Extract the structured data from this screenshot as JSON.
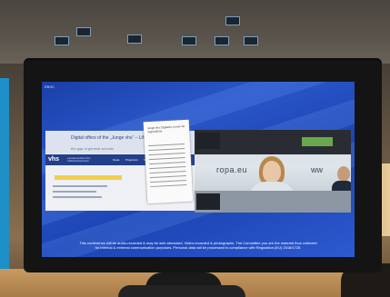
{
  "screen": {
    "corner_label": "EBSC",
    "footer_line1": "This conference will be audio-recorded & may be web-streamed. Video-recorded & photographs. The Committee you are the material thus collected",
    "footer_line2": "for internal & external communication purposes. Personal data will be processed in compliance with Regulation (EU) 2018/1725."
  },
  "slide": {
    "title_line1": "Digital offers of the „Junge vhs“ – Lifting",
    "title_line2": "the gap of general schools",
    "logo": "vhs",
    "logo_caption": "Landesverband der Volkshochschulen",
    "nav": [
      "News",
      "Programm",
      "Newsletter"
    ]
  },
  "card": {
    "heading": "Junge vhs: Digitales Lernen für Jugendliche"
  },
  "video": {
    "sign_left": "ropa.eu",
    "sign_right": "ww"
  }
}
